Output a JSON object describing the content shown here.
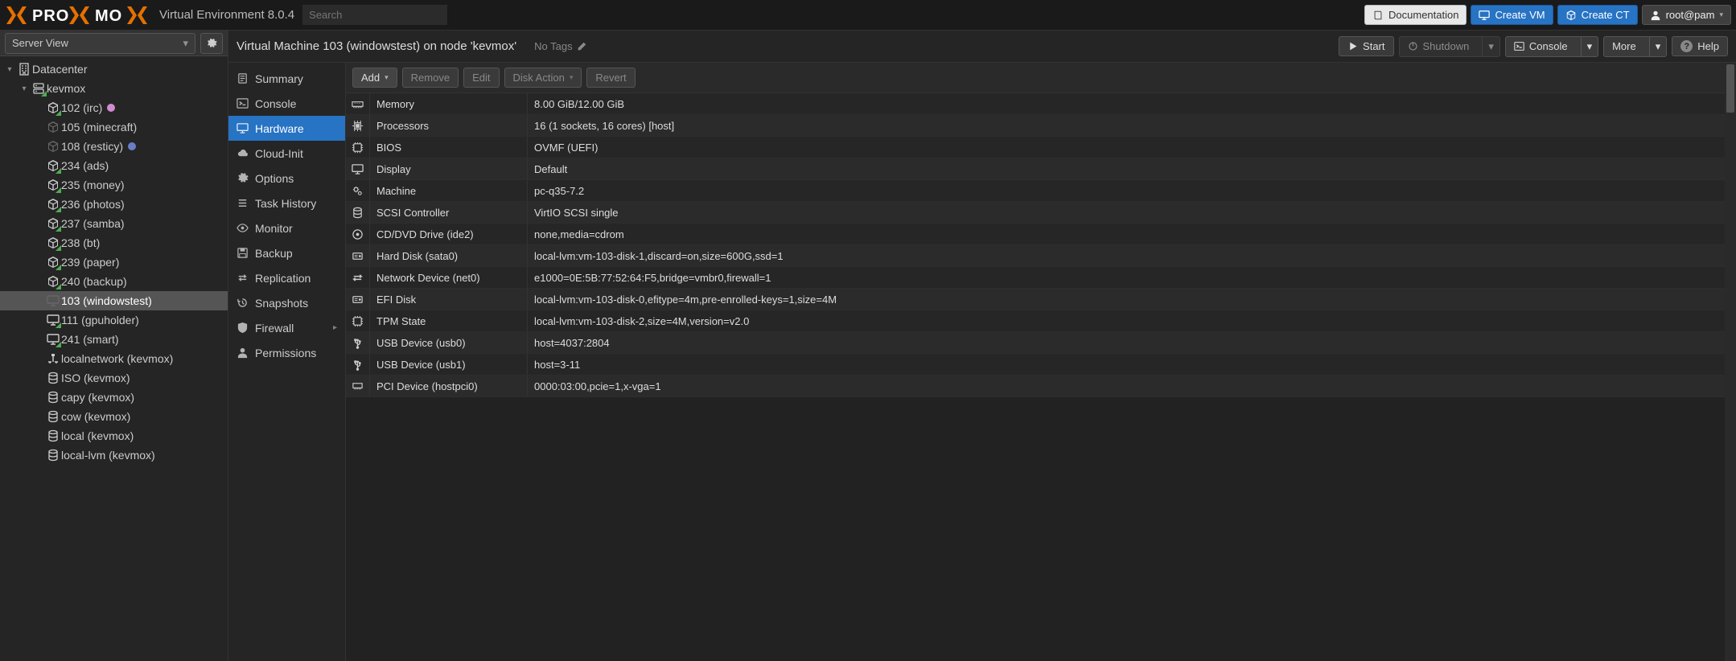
{
  "app": {
    "name": "PROXMOX",
    "suffix": "Virtual Environment 8.0.4",
    "search_placeholder": "Search"
  },
  "header_buttons": {
    "docs": "Documentation",
    "create_vm": "Create VM",
    "create_ct": "Create CT",
    "user": "root@pam"
  },
  "tree": {
    "view_label": "Server View",
    "datacenter": "Datacenter",
    "node": "kevmox",
    "items": [
      {
        "label": "102 (irc)",
        "type": "ct-run",
        "tag": "#d18bd1"
      },
      {
        "label": "105 (minecraft)",
        "type": "ct-stop"
      },
      {
        "label": "108 (resticy)",
        "type": "ct-stop",
        "tag": "#6a7dc9"
      },
      {
        "label": "234 (ads)",
        "type": "ct-run"
      },
      {
        "label": "235 (money)",
        "type": "ct-run"
      },
      {
        "label": "236 (photos)",
        "type": "ct-run"
      },
      {
        "label": "237 (samba)",
        "type": "ct-run"
      },
      {
        "label": "238 (bt)",
        "type": "ct-run"
      },
      {
        "label": "239 (paper)",
        "type": "ct-run"
      },
      {
        "label": "240 (backup)",
        "type": "ct-run"
      },
      {
        "label": "103 (windowstest)",
        "type": "vm-stop",
        "selected": true
      },
      {
        "label": "111 (gpuholder)",
        "type": "vm-run"
      },
      {
        "label": "241 (smart)",
        "type": "vm-run"
      },
      {
        "label": "localnetwork (kevmox)",
        "type": "net"
      },
      {
        "label": "ISO (kevmox)",
        "type": "store"
      },
      {
        "label": "capy (kevmox)",
        "type": "store"
      },
      {
        "label": "cow (kevmox)",
        "type": "store"
      },
      {
        "label": "local (kevmox)",
        "type": "store"
      },
      {
        "label": "local-lvm (kevmox)",
        "type": "store"
      }
    ]
  },
  "content": {
    "title": "Virtual Machine 103 (windowstest) on node 'kevmox'",
    "no_tags": "No Tags",
    "actions": {
      "start": "Start",
      "shutdown": "Shutdown",
      "console": "Console",
      "more": "More",
      "help": "Help"
    }
  },
  "subnav": [
    {
      "label": "Summary",
      "icon": "note"
    },
    {
      "label": "Console",
      "icon": "terminal"
    },
    {
      "label": "Hardware",
      "icon": "desktop",
      "selected": true
    },
    {
      "label": "Cloud-Init",
      "icon": "cloud"
    },
    {
      "label": "Options",
      "icon": "gear"
    },
    {
      "label": "Task History",
      "icon": "list"
    },
    {
      "label": "Monitor",
      "icon": "eye"
    },
    {
      "label": "Backup",
      "icon": "save"
    },
    {
      "label": "Replication",
      "icon": "swap"
    },
    {
      "label": "Snapshots",
      "icon": "history"
    },
    {
      "label": "Firewall",
      "icon": "shield",
      "chevron": true
    },
    {
      "label": "Permissions",
      "icon": "user"
    }
  ],
  "toolbar": {
    "add": "Add",
    "remove": "Remove",
    "edit": "Edit",
    "disk_action": "Disk Action",
    "revert": "Revert"
  },
  "hardware": [
    {
      "icon": "memory",
      "key": "Memory",
      "val": "8.00 GiB/12.00 GiB"
    },
    {
      "icon": "cpu",
      "key": "Processors",
      "val": "16 (1 sockets, 16 cores) [host]"
    },
    {
      "icon": "chip",
      "key": "BIOS",
      "val": "OVMF (UEFI)"
    },
    {
      "icon": "desktop",
      "key": "Display",
      "val": "Default"
    },
    {
      "icon": "cogs",
      "key": "Machine",
      "val": "pc-q35-7.2"
    },
    {
      "icon": "db",
      "key": "SCSI Controller",
      "val": "VirtIO SCSI single"
    },
    {
      "icon": "disc",
      "key": "CD/DVD Drive (ide2)",
      "val": "none,media=cdrom"
    },
    {
      "icon": "hdd",
      "key": "Hard Disk (sata0)",
      "val": "local-lvm:vm-103-disk-1,discard=on,size=600G,ssd=1"
    },
    {
      "icon": "net",
      "key": "Network Device (net0)",
      "val": "e1000=0E:5B:77:52:64:F5,bridge=vmbr0,firewall=1"
    },
    {
      "icon": "hdd",
      "key": "EFI Disk",
      "val": "local-lvm:vm-103-disk-0,efitype=4m,pre-enrolled-keys=1,size=4M"
    },
    {
      "icon": "chip",
      "key": "TPM State",
      "val": "local-lvm:vm-103-disk-2,size=4M,version=v2.0"
    },
    {
      "icon": "usb",
      "key": "USB Device (usb0)",
      "val": "host=4037:2804"
    },
    {
      "icon": "usb",
      "key": "USB Device (usb1)",
      "val": "host=3-11"
    },
    {
      "icon": "pci",
      "key": "PCI Device (hostpci0)",
      "val": "0000:03:00,pcie=1,x-vga=1"
    }
  ]
}
